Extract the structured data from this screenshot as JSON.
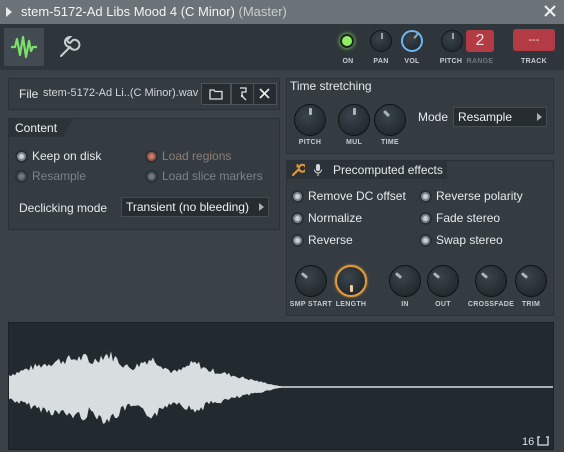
{
  "window": {
    "title": "stem-5172-Ad Libs Mood 4 (C Minor)",
    "subtitle": "(Master)"
  },
  "toolbar": {
    "on_label": "ON",
    "pan_label": "PAN",
    "vol_label": "VOL",
    "pitch_label": "PITCH",
    "range_label": "RANGE",
    "range_value": "2",
    "track_label": "TRACK",
    "track_value": "---",
    "icons": [
      "waveform-icon",
      "wrench-icon"
    ],
    "colors": {
      "accent_green": "#8ef060",
      "accent_red": "#b33b46",
      "accent_blue": "#6cb7f0"
    }
  },
  "file": {
    "label": "File",
    "name": "stem-5172-Ad Li..(C Minor).wav",
    "buttons": [
      "folder-icon",
      "browse-icon",
      "close-icon"
    ]
  },
  "content": {
    "title": "Content",
    "options": {
      "keep_on_disk": "Keep on disk",
      "resample": "Resample",
      "load_regions": "Load regions",
      "load_slice_markers": "Load slice markers"
    },
    "declicking_label": "Declicking mode",
    "declicking_value": "Transient (no bleeding)"
  },
  "time_stretching": {
    "title": "Time stretching",
    "knobs": {
      "pitch": "PITCH",
      "mul": "MUL",
      "time": "TIME"
    },
    "mode_label": "Mode",
    "mode_value": "Resample"
  },
  "precomputed": {
    "title": "Precomputed effects",
    "effects": {
      "remove_dc": "Remove DC offset",
      "reverse_polarity": "Reverse polarity",
      "normalize": "Normalize",
      "fade_stereo": "Fade stereo",
      "reverse": "Reverse",
      "swap_stereo": "Swap stereo"
    },
    "knobs": {
      "smp_start": "SMP START",
      "length": "LENGTH",
      "in": "IN",
      "out": "OUT",
      "crossfade": "CROSSFADE",
      "trim": "TRIM"
    }
  },
  "waveform": {
    "footer_value": "16",
    "color": "#d8dde0"
  }
}
